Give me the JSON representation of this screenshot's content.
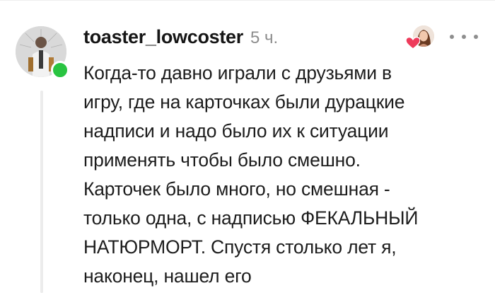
{
  "comment": {
    "author": "toaster_lowcoster",
    "time_ago": "5 ч.",
    "author_online": true,
    "lines": [
      "Когда-то давно играли с друзьями в",
      "игру, где на карточках были дурацкие",
      "надписи и надо было их к ситуации",
      "применять чтобы было смешно.",
      "Карточек было много, но смешная -",
      "только одна, с надписью ФЕКАЛЬНЫЙ",
      "НАТЮРМОРТ. Спустя столько лет я,",
      "наконец, нашел его"
    ]
  },
  "icons": {
    "avatar": "author-avatar-photo",
    "online": "online-status-dot",
    "like": "heart-icon",
    "liker": "liker-avatar-photo",
    "more": "more-options-icon"
  },
  "colors": {
    "online": "#29c441",
    "heart": "#ee3b5b",
    "timestamp": "#8d8d8d",
    "thread_line": "#ececec"
  }
}
